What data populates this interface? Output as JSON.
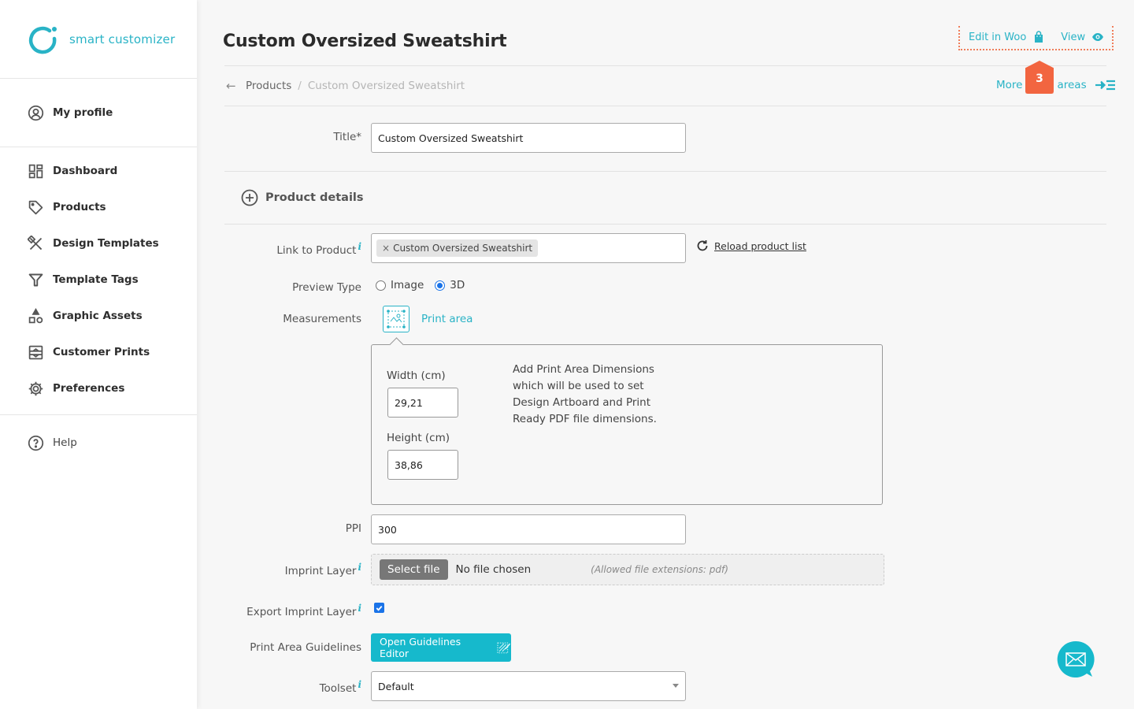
{
  "brand": {
    "name": "smart customizer",
    "color": "#29b3c6"
  },
  "sidebar": {
    "profile": {
      "label": "My profile",
      "icon": "user-circle-icon"
    },
    "items": [
      {
        "label": "Dashboard",
        "icon": "dashboard-icon"
      },
      {
        "label": "Products",
        "icon": "tag-icon"
      },
      {
        "label": "Design Templates",
        "icon": "design-tools-icon"
      },
      {
        "label": "Template Tags",
        "icon": "filter-icon"
      },
      {
        "label": "Graphic Assets",
        "icon": "shapes-icon"
      },
      {
        "label": "Customer Prints",
        "icon": "prints-icon"
      },
      {
        "label": "Preferences",
        "icon": "gear-icon"
      }
    ],
    "help": {
      "label": "Help",
      "icon": "help-circle-icon"
    }
  },
  "header": {
    "title": "Custom Oversized Sweatshirt",
    "actions": {
      "edit_in_woo": "Edit in Woo",
      "view": "View"
    },
    "breadcrumb": {
      "parent": "Products",
      "separator": "/",
      "current": "Custom Oversized Sweatshirt"
    },
    "more_areas": {
      "left": "More",
      "right": "areas"
    },
    "badge": "3"
  },
  "form": {
    "title": {
      "label": "Title*",
      "value": "Custom Oversized Sweatshirt"
    },
    "section": {
      "label": "Product details"
    },
    "link_to_product": {
      "label": "Link to Product",
      "info": "i",
      "tag": "Custom Oversized Sweatshirt",
      "tag_remove": "×",
      "reload": "Reload product list"
    },
    "preview_type": {
      "label": "Preview Type",
      "options": [
        {
          "label": "Image",
          "selected": false
        },
        {
          "label": "3D",
          "selected": true
        }
      ]
    },
    "measurements": {
      "label": "Measurements",
      "print_area_link": "Print area",
      "width_label": "Width (cm)",
      "width_value": "29,21",
      "height_label": "Height (cm)",
      "height_value": "38,86",
      "description": "Add Print Area Dimensions which will be used to set Design Artboard and Print Ready PDF file dimensions."
    },
    "ppi": {
      "label": "PPI",
      "value": "300"
    },
    "imprint_layer": {
      "label": "Imprint Layer",
      "info": "i",
      "button": "Select file",
      "status": "No file chosen",
      "hint": "(Allowed file extensions: pdf)"
    },
    "export_imprint_layer": {
      "label": "Export Imprint Layer",
      "info": "i",
      "checked": true
    },
    "print_area_guidelines": {
      "label": "Print Area Guidelines",
      "button": "Open Guidelines Editor"
    },
    "toolset": {
      "label": "Toolset",
      "info": "i",
      "value": "Default"
    }
  },
  "colors": {
    "accent": "#29b3c6",
    "button": "#16b9cc",
    "badge": "#f26540",
    "checkbox": "#1a73e8"
  }
}
